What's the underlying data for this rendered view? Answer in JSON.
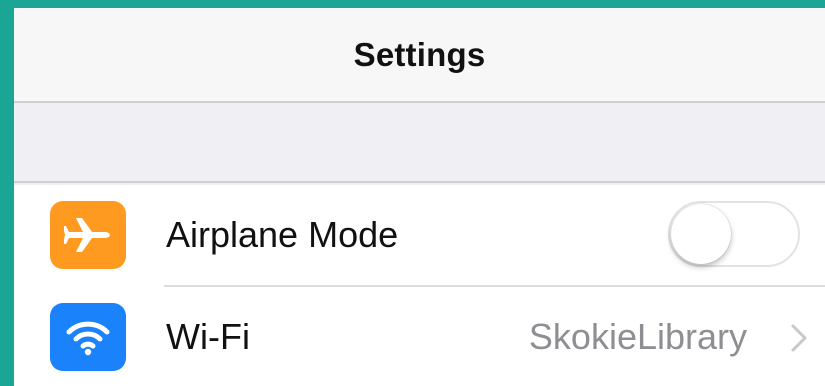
{
  "nav": {
    "title": "Settings"
  },
  "settings": {
    "items": [
      {
        "label": "Airplane Mode",
        "icon": "airplane-icon",
        "icon_color": "#fe9a1f",
        "control": "toggle",
        "toggle_on": false
      },
      {
        "label": "Wi-Fi",
        "icon": "wifi-icon",
        "icon_color": "#1a82fb",
        "control": "disclosure",
        "value": "SkokieLibrary"
      }
    ]
  },
  "colors": {
    "frame": "#1aa594",
    "nav_background": "#f7f7f7",
    "group_background": "#efeff4",
    "secondary_text": "#8e8e93"
  }
}
